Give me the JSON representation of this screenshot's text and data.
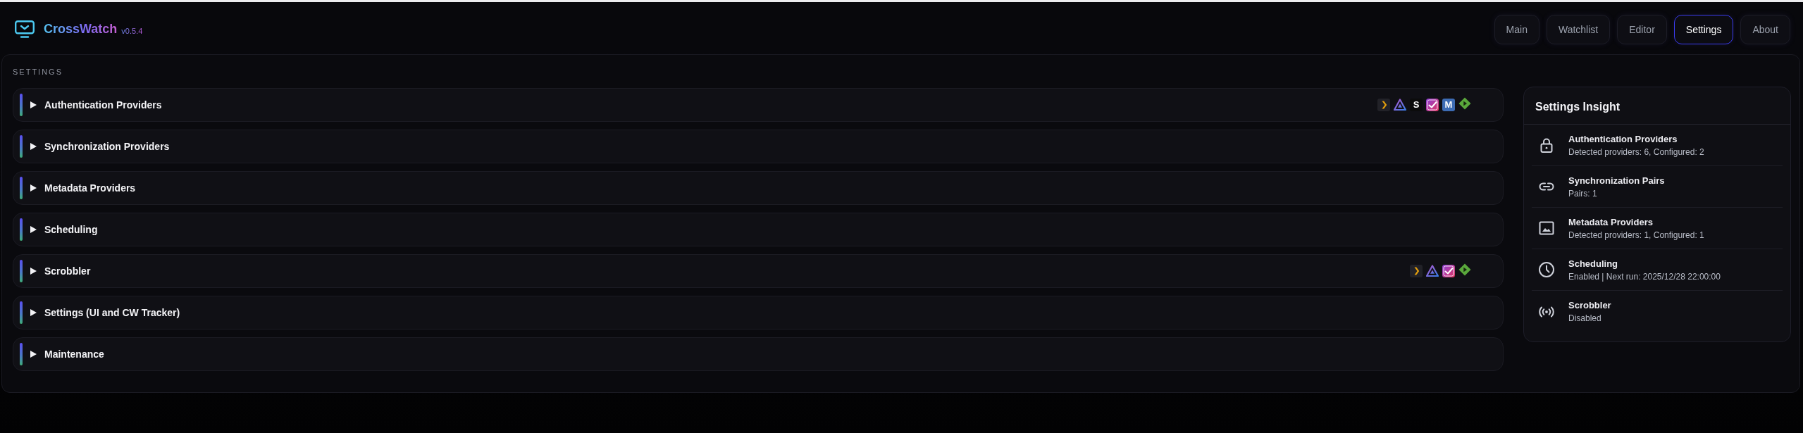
{
  "header": {
    "brand": "CrossWatch",
    "version": "v0.5.4",
    "tabs": [
      {
        "label": "Main",
        "selected": false
      },
      {
        "label": "Watchlist",
        "selected": false
      },
      {
        "label": "Editor",
        "selected": false
      },
      {
        "label": "Settings",
        "selected": true
      },
      {
        "label": "About",
        "selected": false
      }
    ]
  },
  "settings": {
    "heading": "SETTINGS",
    "sections": [
      {
        "title": "Authentication Providers",
        "expanded": false,
        "providers": [
          {
            "kind": "chevron"
          },
          {
            "kind": "triangle"
          },
          {
            "kind": "letter",
            "glyph": "S",
            "color": "#0c0c0c"
          },
          {
            "kind": "check"
          },
          {
            "kind": "letter",
            "glyph": "M",
            "color": "#3d6cb4"
          },
          {
            "kind": "diamond"
          }
        ]
      },
      {
        "title": "Synchronization Providers",
        "expanded": false
      },
      {
        "title": "Metadata Providers",
        "expanded": false
      },
      {
        "title": "Scheduling",
        "expanded": false
      },
      {
        "title": "Scrobbler",
        "expanded": false,
        "providers": [
          {
            "kind": "chevron"
          },
          {
            "kind": "triangle"
          },
          {
            "kind": "check"
          },
          {
            "kind": "diamond"
          }
        ]
      },
      {
        "title": "Settings (UI and CW Tracker)",
        "expanded": false
      },
      {
        "title": "Maintenance",
        "expanded": false
      }
    ]
  },
  "insight": {
    "title": "Settings Insight",
    "items": [
      {
        "title": "Authentication Providers",
        "detail": "Detected providers: 6, Configured: 2"
      },
      {
        "title": "Synchronization Pairs",
        "detail": "Pairs: 1"
      },
      {
        "title": "Metadata Providers",
        "detail": "Detected providers: 1, Configured: 1"
      },
      {
        "title": "Scheduling",
        "detail": "Enabled | Next run: 2025/12/28 22:00:00"
      },
      {
        "title": "Scrobbler",
        "detail": "Disabled"
      }
    ]
  }
}
